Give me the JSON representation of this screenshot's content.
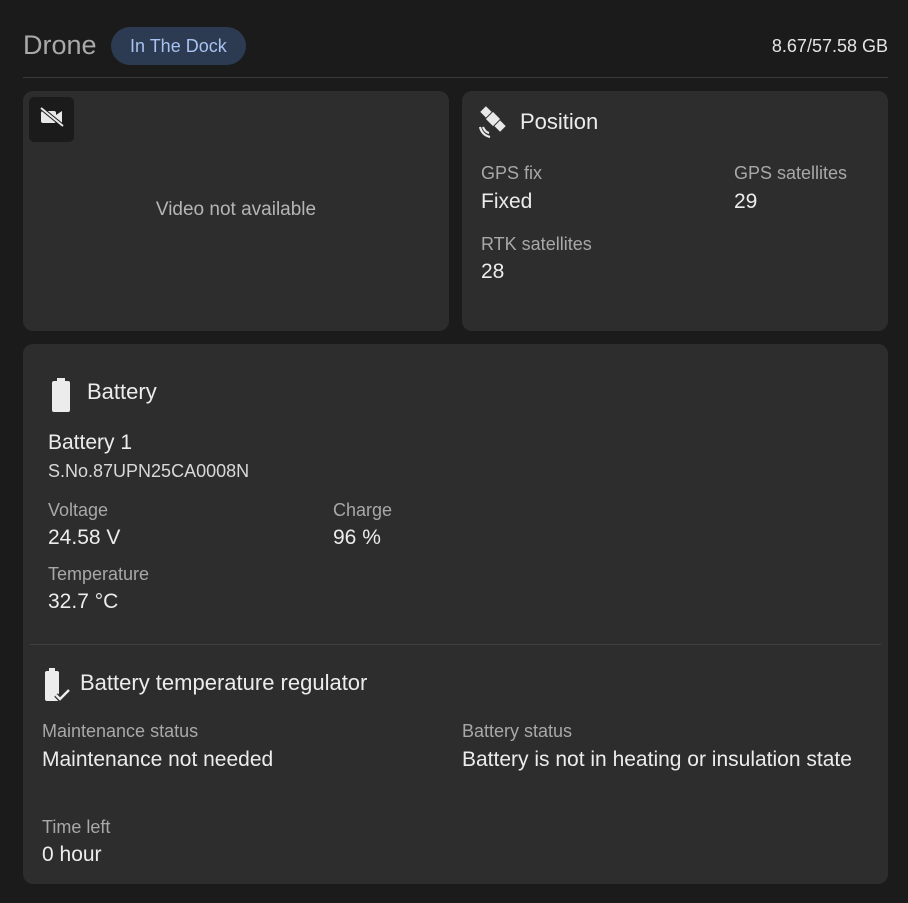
{
  "header": {
    "title": "Drone",
    "badge": "In The Dock",
    "storage": "8.67/57.58 GB"
  },
  "video": {
    "icon": "videocam-off-icon",
    "message": "Video not available"
  },
  "position": {
    "title": "Position",
    "icon": "satellite-icon",
    "gps_fix_label": "GPS fix",
    "gps_fix_value": "Fixed",
    "gps_sat_label": "GPS satellites",
    "gps_sat_value": "29",
    "rtk_sat_label": "RTK satellites",
    "rtk_sat_value": "28"
  },
  "battery": {
    "title": "Battery",
    "icon": "battery-full-icon",
    "name": "Battery 1",
    "serial": "S.No.87UPN25CA0008N",
    "voltage_label": "Voltage",
    "voltage_value": "24.58 V",
    "charge_label": "Charge",
    "charge_value": "96 %",
    "temp_label": "Temperature",
    "temp_value": "32.7 °C"
  },
  "regulator": {
    "title": "Battery temperature regulator",
    "icon": "battery-check-icon",
    "maintenance_label": "Maintenance status",
    "maintenance_value": "Maintenance not needed",
    "status_label": "Battery status",
    "status_value": "Battery is not in heating or insulation state",
    "time_label": "Time left",
    "time_value": "0 hour"
  }
}
